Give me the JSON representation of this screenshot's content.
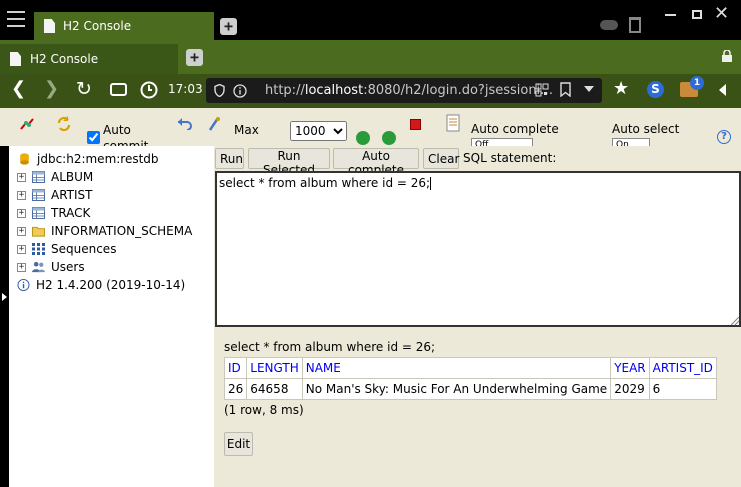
{
  "browser": {
    "window_tab_title": "H2 Console",
    "tab_title": "H2 Console",
    "time": "17:03",
    "url_prefix": "http://",
    "url_host": "localhost",
    "url_rest": ":8080/h2/login.do?jsessioni…",
    "extension_badge": "1"
  },
  "toolbar": {
    "auto_commit_label": "Auto commit",
    "max_label": "Max",
    "max_value": "1000",
    "max_options": [
      "1000"
    ],
    "auto_complete_label": "Auto complete",
    "auto_complete_value": "Off",
    "auto_select_label": "Auto select",
    "auto_select_value": "On",
    "help_label": "?"
  },
  "tree": {
    "connection": "jdbc:h2:mem:restdb",
    "items": [
      {
        "label": "ALBUM",
        "type": "table"
      },
      {
        "label": "ARTIST",
        "type": "table"
      },
      {
        "label": "TRACK",
        "type": "table"
      },
      {
        "label": "INFORMATION_SCHEMA",
        "type": "folder"
      },
      {
        "label": "Sequences",
        "type": "sequences"
      },
      {
        "label": "Users",
        "type": "users"
      }
    ],
    "version": "H2 1.4.200 (2019-10-14)"
  },
  "actions": {
    "run": "Run",
    "run_selected": "Run Selected",
    "auto_complete": "Auto complete",
    "clear": "Clear",
    "sql_statement_label": "SQL statement:"
  },
  "editor": {
    "sql": "select * from album where id = 26;"
  },
  "result": {
    "query": "select * from album where id = 26;",
    "columns": [
      "ID",
      "LENGTH",
      "NAME",
      "YEAR",
      "ARTIST_ID"
    ],
    "rows": [
      [
        "26",
        "64658",
        "No Man's Sky: Music For An Underwhelming Game",
        "2029",
        "6"
      ]
    ],
    "summary": "(1 row, 8 ms)",
    "edit_button": "Edit"
  },
  "colors": {
    "tab_green": "#4b6b1f",
    "nav_green": "#3a5216",
    "app_beige": "#ece9d8",
    "link_blue": "#0000ee"
  }
}
